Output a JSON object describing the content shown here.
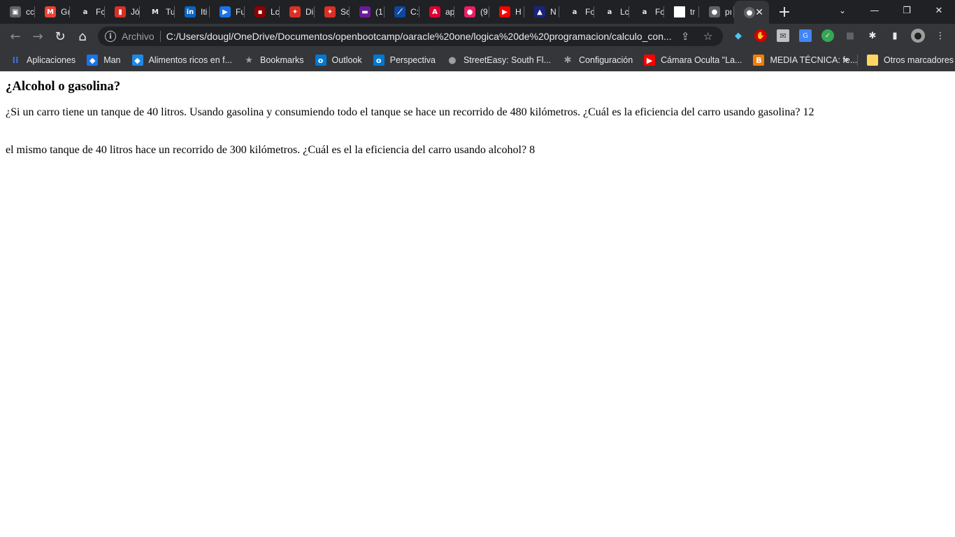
{
  "tabs": [
    {
      "title": "cc",
      "icon": "image-icon",
      "color": "#5f6368"
    },
    {
      "title": "Gı",
      "icon": "gmail-icon",
      "color": "#ea4335"
    },
    {
      "title": "Fc",
      "icon": "amazon-icon",
      "color": "#202124"
    },
    {
      "title": "Jó",
      "icon": "flag-icon",
      "color": "#d93025"
    },
    {
      "title": "Tu",
      "icon": "medium-icon",
      "color": "#202124"
    },
    {
      "title": "Iti",
      "icon": "linkedin-icon",
      "color": "#0a66c2"
    },
    {
      "title": "Fu",
      "icon": "video-icon",
      "color": "#1a73e8"
    },
    {
      "title": "Lc",
      "icon": "logo-icon",
      "color": "#8b0000"
    },
    {
      "title": "Di",
      "icon": "network-icon",
      "color": "#d93025"
    },
    {
      "title": "Sc",
      "icon": "network-icon",
      "color": "#d93025"
    },
    {
      "title": "(1",
      "icon": "mail-icon",
      "color": "#6a1b9a"
    },
    {
      "title": "C:",
      "icon": "code-icon",
      "color": "#0d47a1"
    },
    {
      "title": "ap",
      "icon": "angular-icon",
      "color": "#dd0031"
    },
    {
      "title": "(9",
      "icon": "notification-icon",
      "color": "#e91e63"
    },
    {
      "title": "H",
      "icon": "youtube-icon",
      "color": "#ff0000"
    },
    {
      "title": "N",
      "icon": "app-icon",
      "color": "#1a237e"
    },
    {
      "title": "Fc",
      "icon": "amazon-icon",
      "color": "#202124"
    },
    {
      "title": "Lc",
      "icon": "amazon-icon",
      "color": "#202124"
    },
    {
      "title": "Fc",
      "icon": "amazon-icon",
      "color": "#202124"
    },
    {
      "title": "tr",
      "icon": "page-icon",
      "color": "#ffffff"
    },
    {
      "title": "pı",
      "icon": "globe-icon",
      "color": "#5f6368"
    }
  ],
  "active_tab": {
    "title": "",
    "icon": "globe-icon"
  },
  "omnibox": {
    "scheme": "Archivo",
    "url": "C:/Users/dougl/OneDrive/Documentos/openbootcamp/oaracle%20one/logica%20de%20programacion/calculo_con..."
  },
  "bookmarks": [
    {
      "label": "Aplicaciones",
      "icon": "apps-icon",
      "color": "#4285f4"
    },
    {
      "label": "Man",
      "icon": "bookmark-icon",
      "color": "#1a73e8"
    },
    {
      "label": "Alimentos ricos en f...",
      "icon": "bookmark-icon",
      "color": "#1e88e5"
    },
    {
      "label": "Bookmarks",
      "icon": "star-icon",
      "color": "#9aa0a6"
    },
    {
      "label": "Outlook",
      "icon": "outlook-icon",
      "color": "#0078d4"
    },
    {
      "label": "Perspectiva",
      "icon": "outlook-icon",
      "color": "#0078d4"
    },
    {
      "label": "StreetEasy: South Fl...",
      "icon": "globe-icon",
      "color": "#9aa0a6"
    },
    {
      "label": "Configuración",
      "icon": "gear-icon",
      "color": "#9aa0a6"
    },
    {
      "label": "Cámara Oculta \"La...",
      "icon": "youtube-icon",
      "color": "#ff0000"
    },
    {
      "label": "MEDIA TÉCNICA: fe...",
      "icon": "blogger-icon",
      "color": "#f57c00"
    }
  ],
  "other_bookmarks": "Otros marcadores",
  "page": {
    "heading": "¿Alcohol o gasolina?",
    "paragraph1": "¿Si un carro tiene un tanque de 40 litros. Usando gasolina y consumiendo todo el tanque se hace un recorrido de 480 kilómetros. ¿Cuál es la eficiencia del carro usando gasolina? 12",
    "paragraph2": "el mismo tanque de 40 litros hace un recorrido de 300 kilómetros. ¿Cuál es el la eficiencia del carro usando alcohol? 8"
  }
}
